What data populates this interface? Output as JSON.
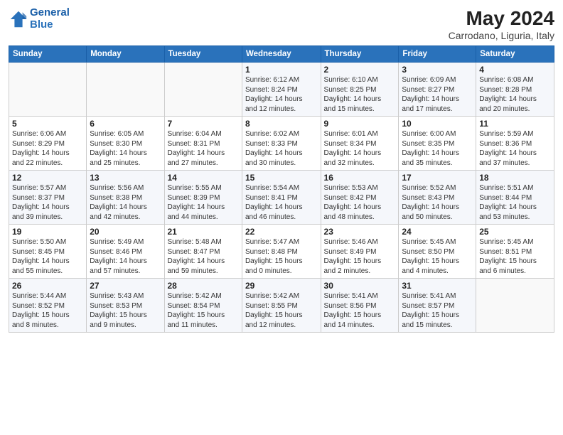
{
  "header": {
    "logo_line1": "General",
    "logo_line2": "Blue",
    "title": "May 2024",
    "subtitle": "Carrodano, Liguria, Italy"
  },
  "days_of_week": [
    "Sunday",
    "Monday",
    "Tuesday",
    "Wednesday",
    "Thursday",
    "Friday",
    "Saturday"
  ],
  "weeks": [
    [
      {
        "num": "",
        "info": ""
      },
      {
        "num": "",
        "info": ""
      },
      {
        "num": "",
        "info": ""
      },
      {
        "num": "1",
        "info": "Sunrise: 6:12 AM\nSunset: 8:24 PM\nDaylight: 14 hours\nand 12 minutes."
      },
      {
        "num": "2",
        "info": "Sunrise: 6:10 AM\nSunset: 8:25 PM\nDaylight: 14 hours\nand 15 minutes."
      },
      {
        "num": "3",
        "info": "Sunrise: 6:09 AM\nSunset: 8:27 PM\nDaylight: 14 hours\nand 17 minutes."
      },
      {
        "num": "4",
        "info": "Sunrise: 6:08 AM\nSunset: 8:28 PM\nDaylight: 14 hours\nand 20 minutes."
      }
    ],
    [
      {
        "num": "5",
        "info": "Sunrise: 6:06 AM\nSunset: 8:29 PM\nDaylight: 14 hours\nand 22 minutes."
      },
      {
        "num": "6",
        "info": "Sunrise: 6:05 AM\nSunset: 8:30 PM\nDaylight: 14 hours\nand 25 minutes."
      },
      {
        "num": "7",
        "info": "Sunrise: 6:04 AM\nSunset: 8:31 PM\nDaylight: 14 hours\nand 27 minutes."
      },
      {
        "num": "8",
        "info": "Sunrise: 6:02 AM\nSunset: 8:33 PM\nDaylight: 14 hours\nand 30 minutes."
      },
      {
        "num": "9",
        "info": "Sunrise: 6:01 AM\nSunset: 8:34 PM\nDaylight: 14 hours\nand 32 minutes."
      },
      {
        "num": "10",
        "info": "Sunrise: 6:00 AM\nSunset: 8:35 PM\nDaylight: 14 hours\nand 35 minutes."
      },
      {
        "num": "11",
        "info": "Sunrise: 5:59 AM\nSunset: 8:36 PM\nDaylight: 14 hours\nand 37 minutes."
      }
    ],
    [
      {
        "num": "12",
        "info": "Sunrise: 5:57 AM\nSunset: 8:37 PM\nDaylight: 14 hours\nand 39 minutes."
      },
      {
        "num": "13",
        "info": "Sunrise: 5:56 AM\nSunset: 8:38 PM\nDaylight: 14 hours\nand 42 minutes."
      },
      {
        "num": "14",
        "info": "Sunrise: 5:55 AM\nSunset: 8:39 PM\nDaylight: 14 hours\nand 44 minutes."
      },
      {
        "num": "15",
        "info": "Sunrise: 5:54 AM\nSunset: 8:41 PM\nDaylight: 14 hours\nand 46 minutes."
      },
      {
        "num": "16",
        "info": "Sunrise: 5:53 AM\nSunset: 8:42 PM\nDaylight: 14 hours\nand 48 minutes."
      },
      {
        "num": "17",
        "info": "Sunrise: 5:52 AM\nSunset: 8:43 PM\nDaylight: 14 hours\nand 50 minutes."
      },
      {
        "num": "18",
        "info": "Sunrise: 5:51 AM\nSunset: 8:44 PM\nDaylight: 14 hours\nand 53 minutes."
      }
    ],
    [
      {
        "num": "19",
        "info": "Sunrise: 5:50 AM\nSunset: 8:45 PM\nDaylight: 14 hours\nand 55 minutes."
      },
      {
        "num": "20",
        "info": "Sunrise: 5:49 AM\nSunset: 8:46 PM\nDaylight: 14 hours\nand 57 minutes."
      },
      {
        "num": "21",
        "info": "Sunrise: 5:48 AM\nSunset: 8:47 PM\nDaylight: 14 hours\nand 59 minutes."
      },
      {
        "num": "22",
        "info": "Sunrise: 5:47 AM\nSunset: 8:48 PM\nDaylight: 15 hours\nand 0 minutes."
      },
      {
        "num": "23",
        "info": "Sunrise: 5:46 AM\nSunset: 8:49 PM\nDaylight: 15 hours\nand 2 minutes."
      },
      {
        "num": "24",
        "info": "Sunrise: 5:45 AM\nSunset: 8:50 PM\nDaylight: 15 hours\nand 4 minutes."
      },
      {
        "num": "25",
        "info": "Sunrise: 5:45 AM\nSunset: 8:51 PM\nDaylight: 15 hours\nand 6 minutes."
      }
    ],
    [
      {
        "num": "26",
        "info": "Sunrise: 5:44 AM\nSunset: 8:52 PM\nDaylight: 15 hours\nand 8 minutes."
      },
      {
        "num": "27",
        "info": "Sunrise: 5:43 AM\nSunset: 8:53 PM\nDaylight: 15 hours\nand 9 minutes."
      },
      {
        "num": "28",
        "info": "Sunrise: 5:42 AM\nSunset: 8:54 PM\nDaylight: 15 hours\nand 11 minutes."
      },
      {
        "num": "29",
        "info": "Sunrise: 5:42 AM\nSunset: 8:55 PM\nDaylight: 15 hours\nand 12 minutes."
      },
      {
        "num": "30",
        "info": "Sunrise: 5:41 AM\nSunset: 8:56 PM\nDaylight: 15 hours\nand 14 minutes."
      },
      {
        "num": "31",
        "info": "Sunrise: 5:41 AM\nSunset: 8:57 PM\nDaylight: 15 hours\nand 15 minutes."
      },
      {
        "num": "",
        "info": ""
      }
    ]
  ]
}
